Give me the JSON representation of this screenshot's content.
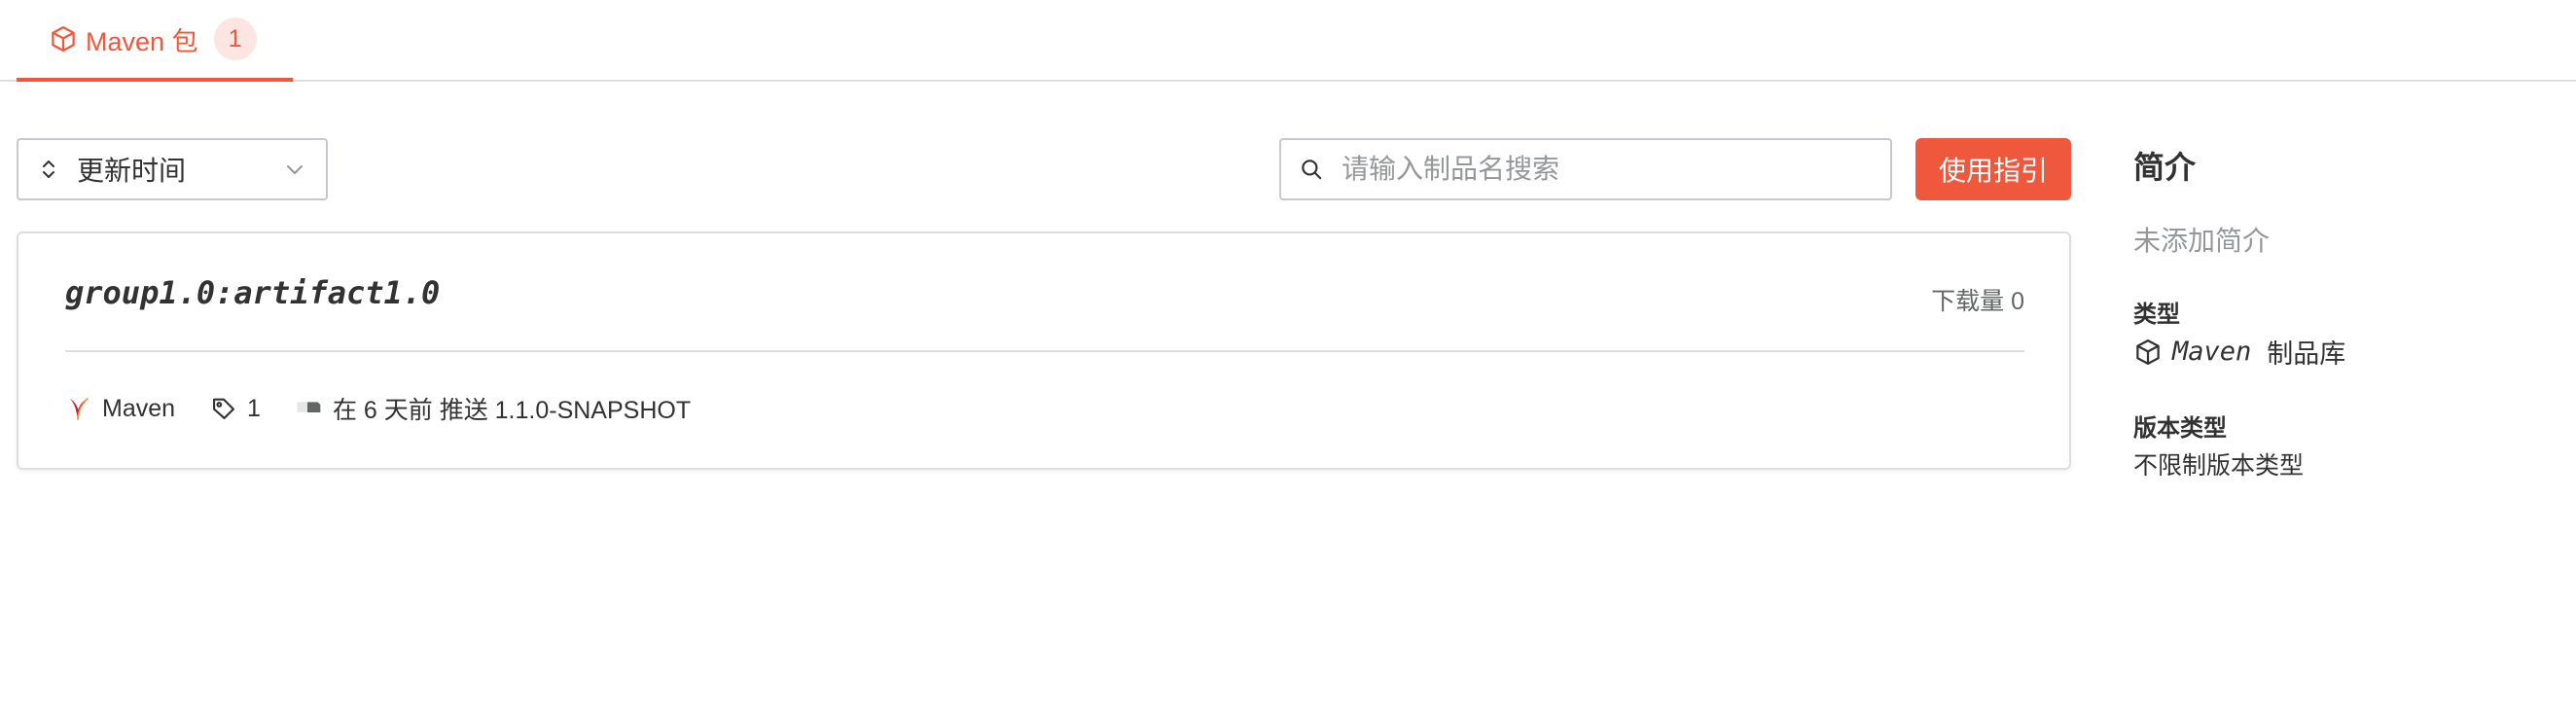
{
  "tabs": [
    {
      "label": "Maven 包",
      "count": "1",
      "icon": "package-icon",
      "active": true
    }
  ],
  "accent_color": "#f0583e",
  "toolbar": {
    "sort_label": "更新时间",
    "search_placeholder": "请输入制品名搜索",
    "search_value": "",
    "guide_button": "使用指引"
  },
  "package": {
    "name": "group1.0:artifact1.0",
    "downloads": "下载量 0",
    "type_label": "Maven",
    "tag_count": "1",
    "push_info": "在 6 天前 推送 1.1.0-SNAPSHOT"
  },
  "side": {
    "title": "简介",
    "description": "未添加简介",
    "type_heading": "类型",
    "type_value": "Maven",
    "type_suffix": "制品库",
    "version_heading": "版本类型",
    "version_value": "不限制版本类型"
  }
}
